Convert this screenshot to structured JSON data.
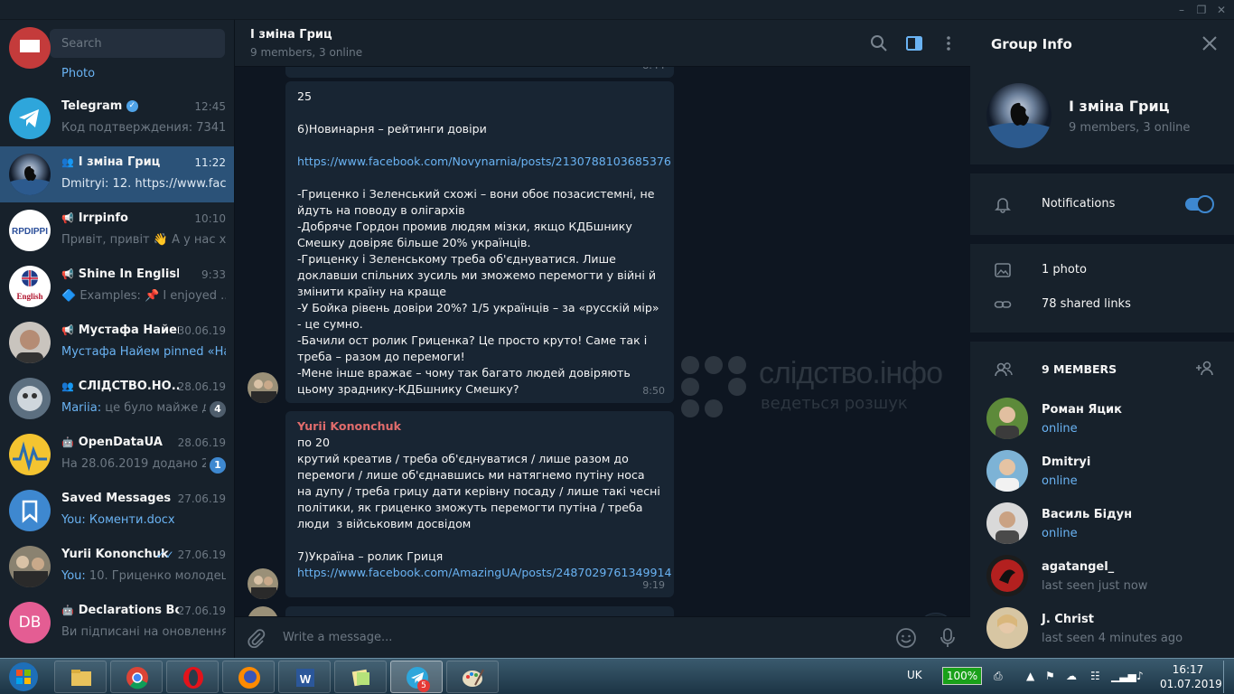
{
  "left": {
    "search_placeholder": "Search",
    "top_partial_preview": "Photo",
    "chats": [
      {
        "name": "Telegram",
        "time": "12:45",
        "preview": "Код подтверждения: 73414...",
        "verified": true
      },
      {
        "name": "І зміна Гриц",
        "time": "11:22",
        "preview": "Dmitryi: 12. https://www.face...",
        "group": true
      },
      {
        "name": "Irrpinfo",
        "time": "10:10",
        "preview": "Привіт,  привіт 👋  А у нас х...",
        "channel": true
      },
      {
        "name": "Shine In English",
        "time": "9:33",
        "preview": "🔷 Examples:  📌 I enjoyed ...",
        "channel": true
      },
      {
        "name": "Мустафа Найем",
        "time": "30.06.19",
        "preview": "Мустафа Найем pinned «На...",
        "channel": true
      },
      {
        "name": "СЛІДСТВО.НО...",
        "time": "28.06.19",
        "preview_sender": "Mariia:",
        "preview": " це було майже д...",
        "badge": "4",
        "group": true
      },
      {
        "name": "OpenDataUA",
        "time": "28.06.19",
        "preview": "На 28.06.2019 додано 2 с...",
        "badge": "1",
        "bot": true
      },
      {
        "name": "Saved Messages",
        "time": "27.06.19",
        "preview_sender": "You:",
        "preview": " Коменти.docx"
      },
      {
        "name": "Yurii Kononchuk",
        "time": "27.06.19",
        "preview_sender": "You:",
        "preview": " 10. Гриценко молодец..."
      },
      {
        "name": "Declarations Bot",
        "time": "27.06.19",
        "preview": "Ви підписані на оновлення ...",
        "bot": true,
        "initials": "DB"
      }
    ]
  },
  "chat": {
    "title": "І зміна Гриц",
    "subtitle": "9 members, 3 online",
    "partial_time": "8:44",
    "messages": [
      {
        "text_1": "25\n\n6)Новинарня – рейтинги довіри\n\n",
        "link": "https://www.facebook.com/Novynarnia/posts/2130788103685376",
        "text_2": "\n\n-Гриценко і Зеленський схожі – вони обоє позасистемні, не йдуть на поводу в олігархів\n-Добряче Гордон промив людям мізки, якщо КДБшнику Смешку довіряє більше 20% українців.\n-Гриценку і Зеленському треба об'єднуватися. Лише доклавши спільних зусиль ми зможемо перемогти у війні й змінити країну на краще\n-У Бойка рівень довіри 20%? 1/5 українців – за «русскій мір» - це сумно.\n-Бачили ост ролик Гриценка? Це просто круто! Саме так і треба – разом до перемоги!\n-Мене інше вражає – чому так багато людей довіряють цьому зрадн­ику-КДБшнику Смешку?",
        "time": "8:50"
      },
      {
        "sender": "Yurii Kononchuk",
        "text_1": "по 20\nкрутий креатив / треба об'єднуватися / лише разом до перемоги / лише об'єднавшись ми натягнемо путіну носа на дупу / треба грицу дати керівну посаду / лише такі чесні політики, як гриценко зможуть перемогти путіна / треба люди  з військовим досвідом\n\n7)Україна – ролик Гриця\n",
        "link": "https://www.facebook.com/AmazingUA/posts/2487029761349914",
        "time": "9:19"
      }
    ],
    "watermark_title": "слідство.інфо",
    "watermark_sub": "ведеться розшук",
    "composer_placeholder": "Write a message..."
  },
  "info": {
    "title": "Group Info",
    "group_name": "І зміна Гриц",
    "group_sub": "9 members, 3 online",
    "notifications_label": "Notifications",
    "notifications_on": true,
    "photos_label": "1 photo",
    "links_label": "78 shared links",
    "members_header": "9 MEMBERS",
    "members": [
      {
        "name": "Роман Яцик",
        "status": "online",
        "online": true
      },
      {
        "name": "Dmitryi",
        "status": "online",
        "online": true
      },
      {
        "name": "Василь Бідун",
        "status": "online",
        "online": true
      },
      {
        "name": "agatangel_",
        "status": "last seen just now",
        "online": false
      },
      {
        "name": "J. Christ",
        "status": "last seen 4 minutes ago",
        "online": false
      }
    ]
  },
  "taskbar": {
    "lang": "UK",
    "battery": "100%",
    "time": "16:17",
    "date": "01.07.2019",
    "telegram_badge": "5"
  },
  "colors": {
    "accent": "#6ab3f3",
    "active_chat": "#2b5278",
    "bg": "#0e1621",
    "panel": "#17212b",
    "bubble": "#182533",
    "sender": "#e06c6c"
  }
}
